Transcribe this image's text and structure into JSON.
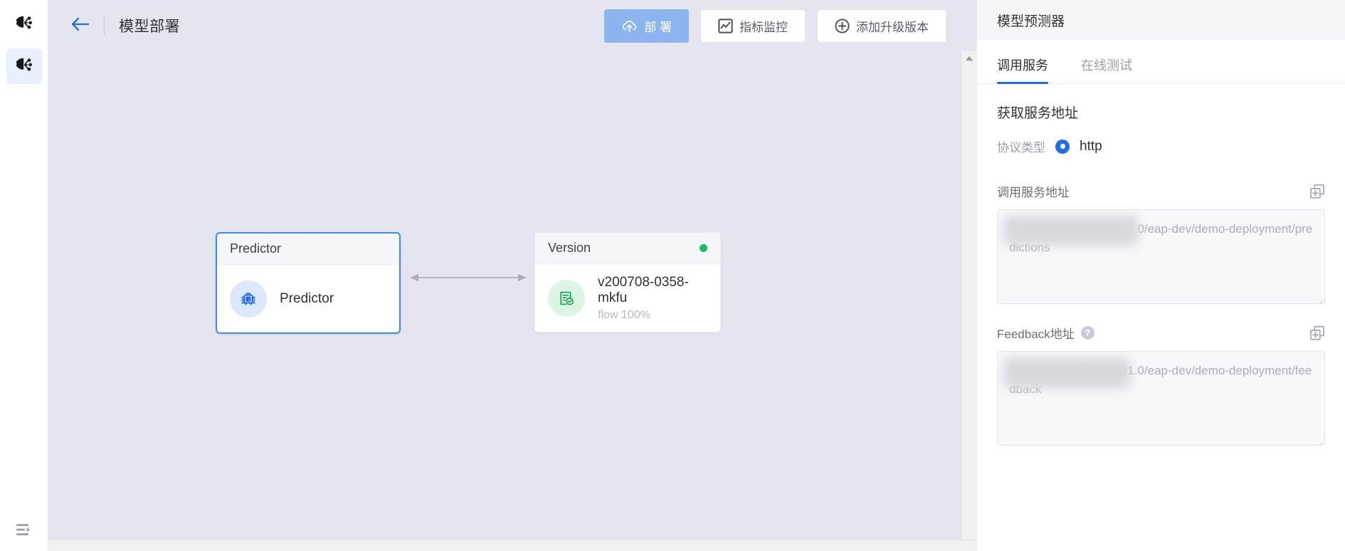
{
  "sidebar": {
    "items": [
      {
        "name": "brand-logo",
        "icon": "brain-network-icon",
        "active": false
      },
      {
        "name": "model-deploy-nav",
        "icon": "brain-network-icon",
        "active": true
      }
    ],
    "bottom": {
      "label": "展开菜单",
      "icon": "expand-menu-icon"
    }
  },
  "toolbar": {
    "back_icon": "arrow-left-icon",
    "title": "模型部署",
    "buttons": [
      {
        "label": "部 署",
        "icon": "cloud-upload-icon",
        "style": "primary"
      },
      {
        "label": "指标监控",
        "icon": "chart-monitor-icon",
        "style": "plain"
      },
      {
        "label": "添加升级版本",
        "icon": "plus-circle-icon",
        "style": "plain"
      }
    ]
  },
  "canvas": {
    "nodes": [
      {
        "header": "Predictor",
        "label": "Predictor",
        "sub": "",
        "icon": "predictor-icon",
        "status_dot": "",
        "selected": true
      },
      {
        "header": "Version",
        "label": "v200708-0358-mkfu",
        "sub": "flow 100%",
        "icon": "version-check-icon",
        "status_dot": "#16c060",
        "selected": false
      }
    ],
    "connector": "double-arrow"
  },
  "panel": {
    "title": "模型预测器",
    "tabs": [
      {
        "label": "调用服务",
        "active": true
      },
      {
        "label": "在线测试",
        "active": false
      }
    ],
    "section_title": "获取服务地址",
    "protocol": {
      "label": "协议类型",
      "value": "http"
    },
    "fields": [
      {
        "label": "调用服务地址",
        "help": false,
        "copy_icon": "copy-icon",
        "value": "/metrics/eap-dev/api/v1.0/eap-dev/demo-deployment/predictions",
        "redacted": true
      },
      {
        "label": "Feedback地址",
        "help": true,
        "help_glyph": "?",
        "copy_icon": "copy-icon",
        "value": "/metrics/eap-dev/api/v1.0/eap-dev/demo-deployment/feedback",
        "redacted": true
      }
    ]
  },
  "colors": {
    "accent": "#1f6fe5",
    "primary_button": "#8cb5f0",
    "canvas_bg": "#e4e5ef",
    "node_selected_border": "#3a8bf5",
    "status_green": "#16c060"
  }
}
